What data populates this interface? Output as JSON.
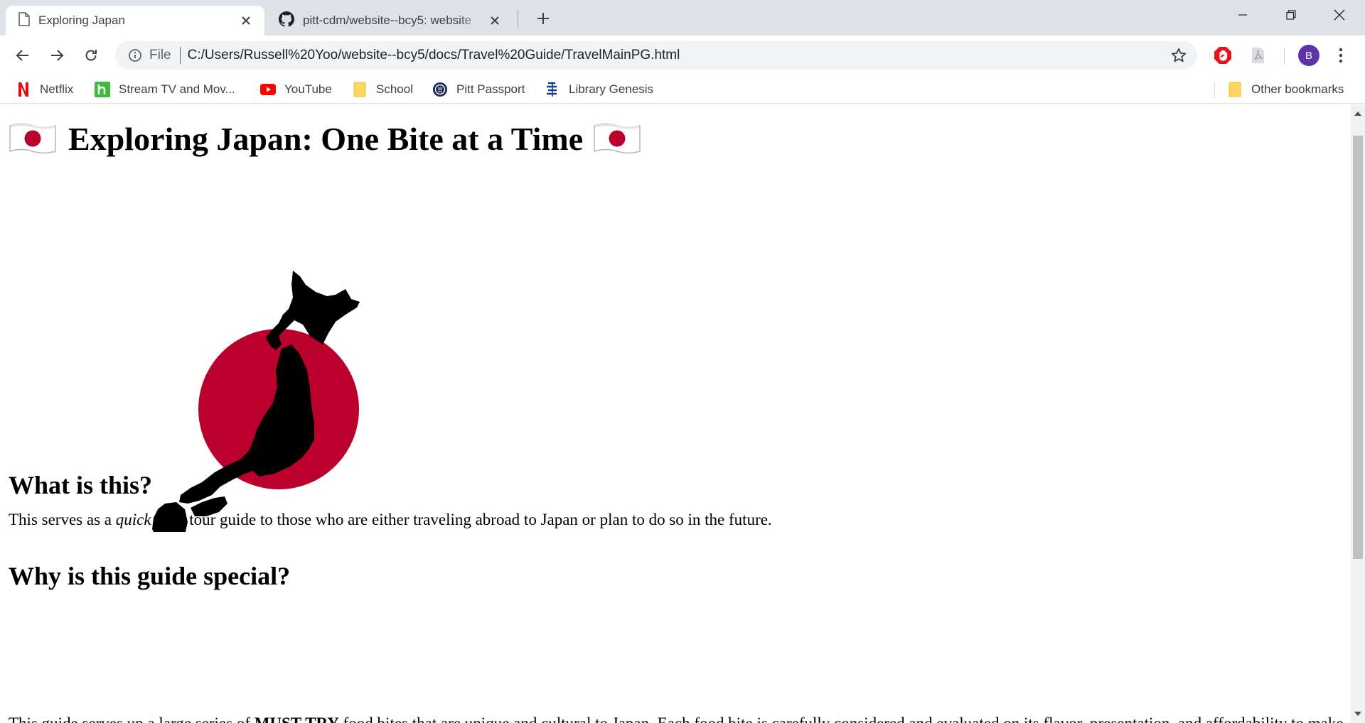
{
  "tabs": [
    {
      "title": "Exploring Japan",
      "icon": "page-icon",
      "active": true
    },
    {
      "title": "pitt-cdm/website--bcy5: website",
      "icon": "github-icon",
      "active": false
    }
  ],
  "window_controls": [
    "minimize-icon",
    "restore-icon",
    "close-icon"
  ],
  "omnibox": {
    "scheme": "File",
    "url": "C:/Users/Russell%20Yoo/website--bcy5/docs/Travel%20Guide/TravelMainPG.html"
  },
  "profile": {
    "initial": "B",
    "color": "#5b34a8"
  },
  "bookmarks": [
    {
      "label": "Netflix",
      "icon": "netflix-icon"
    },
    {
      "label": "Stream TV and Mov...",
      "icon": "hulu-icon"
    },
    {
      "label": "YouTube",
      "icon": "youtube-icon"
    },
    {
      "label": "School",
      "icon": "folder-icon"
    },
    {
      "label": "Pitt Passport",
      "icon": "pitt-icon"
    },
    {
      "label": "Library Genesis",
      "icon": "library-icon"
    }
  ],
  "other_bookmarks": {
    "label": "Other bookmarks",
    "icon": "folder-icon"
  },
  "page": {
    "title": "Exploring Japan: One Bite at a Time",
    "sections": [
      {
        "heading": "What is this?",
        "text_before": "This serves as a ",
        "text_em": "quick",
        "text_after": " food tour guide to those who are either traveling abroad to Japan or plan to do so in the future."
      },
      {
        "heading": "Why is this guide special?",
        "text_before": "This guide serves up a large series of ",
        "text_strong": "MUST TRY",
        "text_after": " food bites that are unique and cultural to Japan. Each food bite is carefully considered and evaluated on its flavor, presentation, and affordability to make"
      }
    ]
  },
  "colors": {
    "flag_red": "#bc002d",
    "tab_strip": "#dee1e6",
    "omnibox": "#f1f3f4"
  }
}
